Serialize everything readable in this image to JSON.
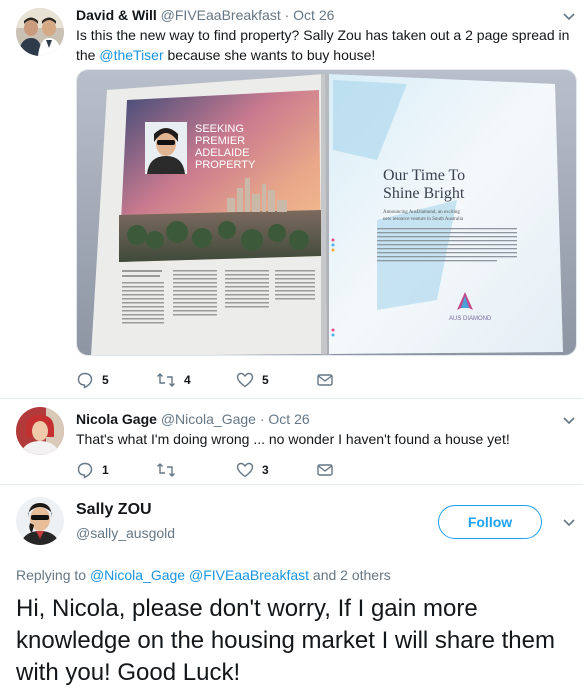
{
  "tweet1": {
    "name": "David & Will",
    "handle": "@FIVEaaBreakfast",
    "date": "· Oct 26",
    "text_1": "Is this the new way to find property? Sally Zou has taken out a 2 page spread in",
    "text_2": "the ",
    "mention": "@theTiser",
    "text_3": " because she wants to buy house!",
    "replies": "5",
    "retweets": "4",
    "likes": "5",
    "newspaper": {
      "left_heading_1": "SEEKING",
      "left_heading_2": "PREMIER",
      "left_heading_3": "ADELAIDE",
      "left_heading_4": "PROPERTY",
      "right_heading_1": "Our Time To",
      "right_heading_2": "Shine Bright",
      "right_sub_1": "Announcing AusDiamond, an exciting",
      "right_sub_2": "new resource venture in South Australia",
      "logo_text": "AUS DIAMOND"
    }
  },
  "tweet2": {
    "name": "Nicola Gage",
    "handle": "@Nicola_Gage",
    "date": "· Oct 26",
    "text": "That's what I'm doing wrong ... no wonder I haven't found a house yet!",
    "replies": "1",
    "retweets": "",
    "likes": "3"
  },
  "tweet3": {
    "name": "Sally ZOU",
    "handle": "@sally_ausgold",
    "follow_label": "Follow",
    "replying_prefix": "Replying to ",
    "replying_m1": "@Nicola_Gage",
    "replying_m2": " @FIVEaaBreakfast",
    "replying_suffix": " and 2 others",
    "text": "Hi, Nicola, please don't worry, If I gain more knowledge on the housing market I will share them with you! Good Luck!"
  },
  "colors": {
    "accent": "#1da1f2",
    "link": "#1b95e0",
    "muted": "#657786",
    "divider": "#e6ecf0"
  }
}
